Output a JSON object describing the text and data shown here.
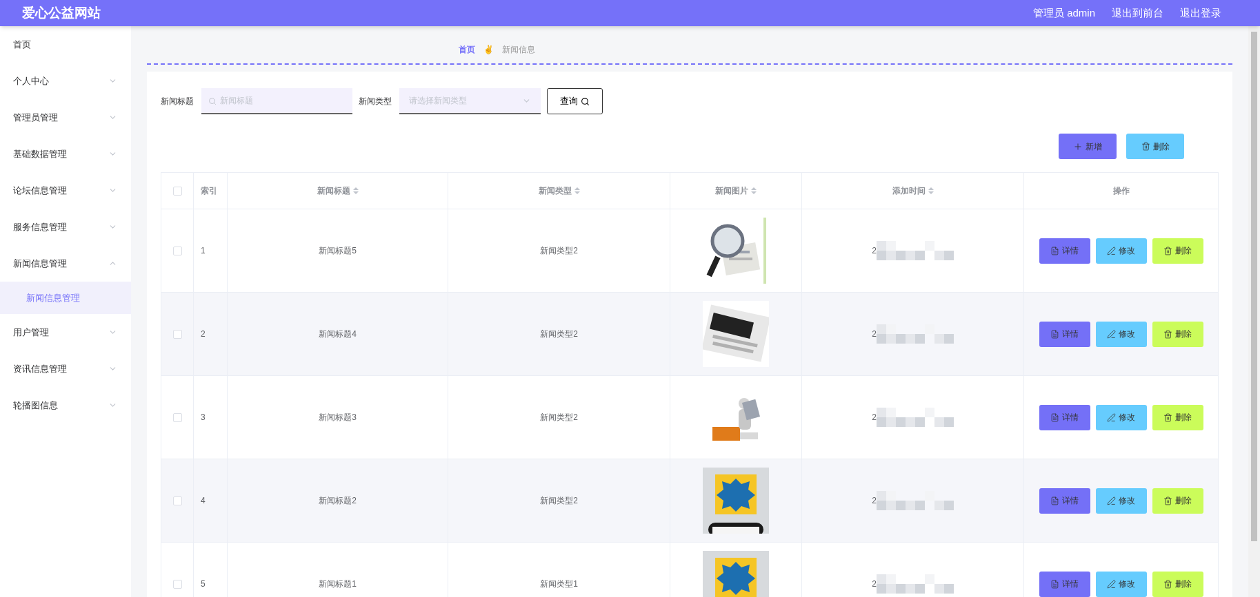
{
  "header": {
    "title": "爱心公益网站",
    "user": "管理员 admin",
    "links": [
      "退出到前台",
      "退出登录"
    ]
  },
  "sidebar": {
    "items": [
      {
        "label": "首页",
        "expandable": false
      },
      {
        "label": "个人中心",
        "expandable": true,
        "expanded": false
      },
      {
        "label": "管理员管理",
        "expandable": true,
        "expanded": false
      },
      {
        "label": "基础数据管理",
        "expandable": true,
        "expanded": false
      },
      {
        "label": "论坛信息管理",
        "expandable": true,
        "expanded": false
      },
      {
        "label": "服务信息管理",
        "expandable": true,
        "expanded": false
      },
      {
        "label": "新闻信息管理",
        "expandable": true,
        "expanded": true,
        "children": [
          {
            "label": "新闻信息管理",
            "selected": true
          }
        ]
      },
      {
        "label": "用户管理",
        "expandable": true,
        "expanded": false
      },
      {
        "label": "资讯信息管理",
        "expandable": true,
        "expanded": false
      },
      {
        "label": "轮播图信息",
        "expandable": true,
        "expanded": false
      }
    ]
  },
  "breadcrumb": {
    "items": [
      "首页",
      "新闻信息"
    ],
    "separator": "✌"
  },
  "search": {
    "fields": [
      {
        "label": "新闻标题",
        "kind": "text",
        "placeholder": "新闻标题"
      },
      {
        "label": "新闻类型",
        "kind": "select",
        "placeholder": "请选择新闻类型"
      }
    ],
    "button": "查询"
  },
  "actions": [
    {
      "label": "新增",
      "kind": "add"
    },
    {
      "label": "删除",
      "kind": "batch_delete"
    }
  ],
  "table": {
    "all_checked": false,
    "columns": [
      {
        "label": "索引",
        "sortable": false
      },
      {
        "label": "新闻标题",
        "sortable": true
      },
      {
        "label": "新闻类型",
        "sortable": true
      },
      {
        "label": "新闻图片",
        "sortable": true
      },
      {
        "label": "添加时间",
        "sortable": true
      },
      {
        "label": "操作",
        "sortable": false
      }
    ],
    "rows": [
      {
        "checked": false,
        "index": "1",
        "title": "新闻标题5",
        "type": "新闻类型2",
        "time": "2",
        "buttons": [
          {
            "label": "详情",
            "kind": "detail"
          },
          {
            "label": "修改",
            "kind": "edit"
          },
          {
            "label": "删除",
            "kind": "delete"
          }
        ]
      },
      {
        "checked": false,
        "index": "2",
        "title": "新闻标题4",
        "type": "新闻类型2",
        "time": "2",
        "buttons": [
          {
            "label": "详情",
            "kind": "detail"
          },
          {
            "label": "修改",
            "kind": "edit"
          },
          {
            "label": "删除",
            "kind": "delete"
          }
        ]
      },
      {
        "checked": false,
        "index": "3",
        "title": "新闻标题3",
        "type": "新闻类型2",
        "time": "2",
        "buttons": [
          {
            "label": "详情",
            "kind": "detail"
          },
          {
            "label": "修改",
            "kind": "edit"
          },
          {
            "label": "删除",
            "kind": "delete"
          }
        ]
      },
      {
        "checked": false,
        "index": "4",
        "title": "新闻标题2",
        "type": "新闻类型2",
        "time": "2",
        "buttons": [
          {
            "label": "详情",
            "kind": "detail"
          },
          {
            "label": "修改",
            "kind": "edit"
          },
          {
            "label": "删除",
            "kind": "delete"
          }
        ]
      },
      {
        "checked": false,
        "index": "5",
        "title": "新闻标题1",
        "type": "新闻类型1",
        "time": "2",
        "buttons": [
          {
            "label": "详情",
            "kind": "detail"
          },
          {
            "label": "修改",
            "kind": "edit"
          },
          {
            "label": "删除",
            "kind": "delete"
          }
        ]
      }
    ]
  }
}
